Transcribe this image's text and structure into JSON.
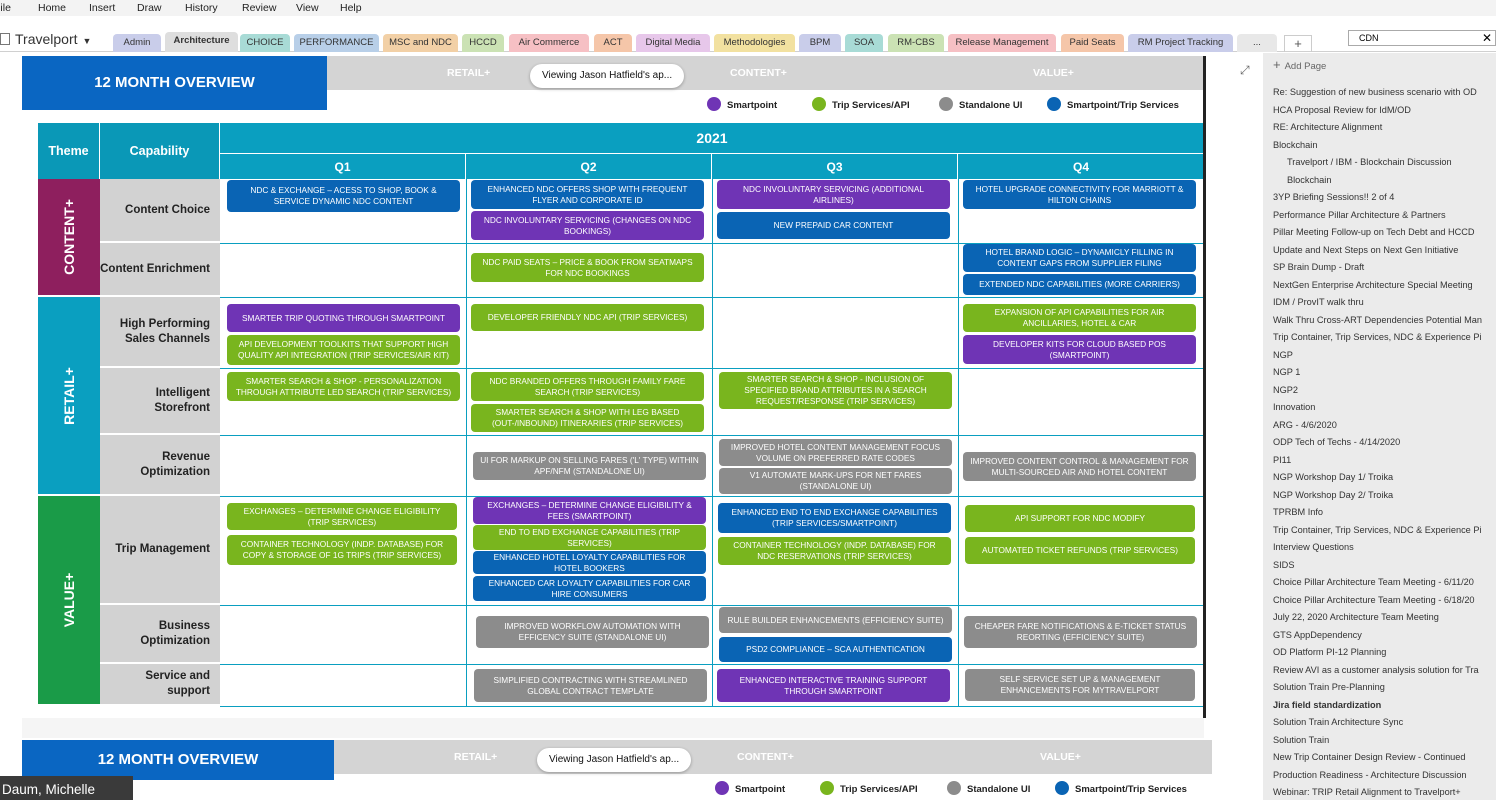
{
  "menu": [
    "File",
    "Home",
    "Insert",
    "Draw",
    "History",
    "Review",
    "View",
    "Help"
  ],
  "notebook": "Travelport",
  "tabs": [
    {
      "label": "Admin",
      "color": "#c9cdea"
    },
    {
      "label": "Architecture",
      "color": "#dedede"
    },
    {
      "label": "CHOICE",
      "color": "#a8dbd6"
    },
    {
      "label": "PERFORMANCE",
      "color": "#b8cfe8"
    },
    {
      "label": "MSC and NDC",
      "color": "#f2d0a6"
    },
    {
      "label": "HCCD",
      "color": "#cbe2b4"
    },
    {
      "label": "Air Commerce",
      "color": "#f6c0c4"
    },
    {
      "label": "ACT",
      "color": "#f5c6a9"
    },
    {
      "label": "Digital Media",
      "color": "#e7c7ea"
    },
    {
      "label": "Methodologies",
      "color": "#f2e1a0"
    },
    {
      "label": "BPM",
      "color": "#c9cdea"
    },
    {
      "label": "SOA",
      "color": "#a8dbd6"
    },
    {
      "label": "RM-CBS",
      "color": "#cbe2b4"
    },
    {
      "label": "Release Management",
      "color": "#f6c0c4"
    },
    {
      "label": "Paid Seats",
      "color": "#f5c6a9"
    },
    {
      "label": "RM Project Tracking",
      "color": "#c9cdea"
    },
    {
      "label": "...",
      "color": "#e8e8e8"
    }
  ],
  "search": {
    "value": "CDN"
  },
  "add_page": "Add Page",
  "pages": [
    {
      "label": "Re: Suggestion of new business scenario with OD"
    },
    {
      "label": "HCA Proposal Review for IdM/OD"
    },
    {
      "label": "RE: Architecture Alignment"
    },
    {
      "label": "Blockchain"
    },
    {
      "label": "Travelport / IBM - Blockchain Discussion",
      "sub": true
    },
    {
      "label": "Blockchain",
      "sub": true
    },
    {
      "label": "3YP Briefing Sessions!!  2 of 4"
    },
    {
      "label": "Performance Pillar Architecture & Partners"
    },
    {
      "label": "Pillar Meeting Follow-up on Tech Debt and HCCD"
    },
    {
      "label": "Update and Next Steps on Next Gen Initiative"
    },
    {
      "label": "SP Brain Dump - Draft"
    },
    {
      "label": "NextGen Enterprise Architecture  Special Meeting"
    },
    {
      "label": "IDM / ProvIT walk thru"
    },
    {
      "label": "Walk Thru Cross-ART Dependencies Potential Man"
    },
    {
      "label": "Trip Container, Trip Services, NDC & Experience Pi"
    },
    {
      "label": "NGP"
    },
    {
      "label": "NGP 1"
    },
    {
      "label": "NGP2"
    },
    {
      "label": "Innovation"
    },
    {
      "label": "ARG - 4/6/2020"
    },
    {
      "label": "ODP Tech of Techs - 4/14/2020"
    },
    {
      "label": "PI11"
    },
    {
      "label": "NGP Workshop Day 1/ Troika"
    },
    {
      "label": "NGP Workshop Day 2/ Troika"
    },
    {
      "label": "TPRBM Info"
    },
    {
      "label": "Trip Container, Trip Services, NDC & Experience Pi"
    },
    {
      "label": "Interview Questions"
    },
    {
      "label": "SIDS"
    },
    {
      "label": "Choice Pillar Architecture Team Meeting - 6/11/20"
    },
    {
      "label": "Choice Pillar Architecture Team Meeting - 6/18/20"
    },
    {
      "label": "July 22, 2020 Architecture Team Meeting"
    },
    {
      "label": "GTS AppDependency"
    },
    {
      "label": "OD Platform PI-12 Planning"
    },
    {
      "label": "Review AVI as a customer analysis solution for Tra"
    },
    {
      "label": "Solution Train Pre-Planning"
    },
    {
      "label": "Jira field standardization",
      "bold": true
    },
    {
      "label": "Solution Train Architecture Sync"
    },
    {
      "label": "Solution Train"
    },
    {
      "label": "New Trip Container Design Review - Continued"
    },
    {
      "label": "Production Readiness - Architecture Discussion"
    },
    {
      "label": "Webinar: TRIP Retail Alignment to Travelport+"
    }
  ],
  "slide": {
    "title": "12 MONTH OVERVIEW",
    "header_labels": [
      "RETAIL+",
      "CONTENT+",
      "VALUE+"
    ],
    "viewing": "Viewing Jason Hatfield's ap...",
    "legend": [
      {
        "label": "Smartpoint",
        "color": "#6f34b5"
      },
      {
        "label": "Trip Services/API",
        "color": "#79b51e"
      },
      {
        "label": "Standalone UI",
        "color": "#8c8c8c"
      },
      {
        "label": "Smartpoint/Trip Services",
        "color": "#0a64b4"
      }
    ],
    "col_theme": "Theme",
    "col_capability": "Capability",
    "year": "2021",
    "quarters": [
      "Q1",
      "Q2",
      "Q3",
      "Q4"
    ],
    "themes": [
      {
        "label": "CONTENT+",
        "color": "#8e1f5e"
      },
      {
        "label": "RETAIL+",
        "color": "#0a9fc0"
      },
      {
        "label": "VALUE+",
        "color": "#1a9b48"
      }
    ],
    "capabilities": [
      "Content Choice",
      "Content Enrichment",
      "High Performing Sales Channels",
      "Intelligent Storefront",
      "Revenue Optimization",
      "Trip Management",
      "Business Optimization",
      "Service and support"
    ],
    "items": [
      {
        "text": "NDC & EXCHANGE – ACESS TO SHOP, BOOK & SERVICE DYNAMIC NDC CONTENT",
        "color": "blue"
      },
      {
        "text": "ENHANCED NDC OFFERS SHOP WITH FREQUENT FLYER AND  CORPORATE ID",
        "color": "blue"
      },
      {
        "text": "NDC INVOLUNTARY SERVICING (CHANGES ON NDC BOOKINGS)",
        "color": "purple"
      },
      {
        "text": "NDC INVOLUNTARY SERVICING (ADDITIONAL AIRLINES)",
        "color": "purple"
      },
      {
        "text": "NEW PREPAID CAR CONTENT",
        "color": "blue"
      },
      {
        "text": "HOTEL UPGRADE CONNECTIVITY FOR MARRIOTT & HILTON CHAINS",
        "color": "blue"
      },
      {
        "text": "NDC PAID SEATS – PRICE & BOOK FROM SEATMAPS FOR NDC BOOKINGS",
        "color": "green"
      },
      {
        "text": "HOTEL BRAND LOGIC – DYNAMICLY FILLING IN CONTENT GAPS FROM SUPPLIER FILING",
        "color": "blue"
      },
      {
        "text": "EXTENDED NDC CAPABILITIES (MORE CARRIERS)",
        "color": "blue"
      },
      {
        "text": "SMARTER TRIP QUOTING THROUGH SMARTPOINT",
        "color": "purple"
      },
      {
        "text": "API DEVELOPMENT TOOLKITS THAT SUPPORT HIGH QUALITY API INTEGRATION (TRIP SERVICES/AIR KIT)",
        "color": "green"
      },
      {
        "text": "DEVELOPER FRIENDLY NDC API (TRIP SERVICES)",
        "color": "green"
      },
      {
        "text": "EXPANSION OF API CAPABILITIES FOR AIR ANCILLARIES, HOTEL & CAR",
        "color": "green"
      },
      {
        "text": "DEVELOPER KITS FOR CLOUD BASED POS (SMARTPOINT)",
        "color": "purple"
      },
      {
        "text": "SMARTER SEARCH & SHOP - PERSONALIZATION THROUGH ATTRIBUTE LED SEARCH (TRIP SERVICES)",
        "color": "green"
      },
      {
        "text": "NDC BRANDED OFFERS THROUGH FAMILY FARE SEARCH (TRIP SERVICES)",
        "color": "green"
      },
      {
        "text": "SMARTER SEARCH & SHOP WITH LEG BASED (OUT-/INBOUND) ITINERARIES (TRIP SERVICES)",
        "color": "green"
      },
      {
        "text": "SMARTER SEARCH & SHOP - INCLUSION OF SPECIFIED BRAND ATTRIBUTES IN A SEARCH REQUEST/RESPONSE  (TRIP SERVICES)",
        "color": "green"
      },
      {
        "text": "UI FOR MARKUP ON SELLING FARES ('L' TYPE) WITHIN APF/NFM (STANDALONE UI)",
        "color": "grey"
      },
      {
        "text": "IMPROVED HOTEL CONTENT MANAGEMENT FOCUS VOLUME ON PREFERRED RATE CODES",
        "color": "grey"
      },
      {
        "text": "V1 AUTOMATE MARK-UPS FOR NET FARES (STANDALONE UI)",
        "color": "grey"
      },
      {
        "text": "IMPROVED CONTENT CONTROL & MANAGEMENT FOR MULTI-SOURCED AIR AND HOTEL CONTENT",
        "color": "grey"
      },
      {
        "text": "EXCHANGES – DETERMINE CHANGE ELIGIBILITY (TRIP SERVICES)",
        "color": "green"
      },
      {
        "text": "CONTAINER TECHNOLOGY (INDP. DATABASE) FOR COPY & STORAGE OF 1G TRIPS  (TRIP SERVICES)",
        "color": "green"
      },
      {
        "text": "EXCHANGES – DETERMINE CHANGE ELIGIBILITY & FEES (SMARTPOINT)",
        "color": "purple"
      },
      {
        "text": "END TO END EXCHANGE CAPABILITIES (TRIP SERVICES)",
        "color": "green"
      },
      {
        "text": "ENHANCED HOTEL LOYALTY CAPABILITIES FOR HOTEL BOOKERS",
        "color": "blue"
      },
      {
        "text": "ENHANCED CAR LOYALTY CAPABILITIES FOR CAR HIRE CONSUMERS",
        "color": "blue"
      },
      {
        "text": "ENHANCED END TO END EXCHANGE CAPABILITIES (TRIP SERVICES/SMARTPOINT)",
        "color": "blue"
      },
      {
        "text": "CONTAINER TECHNOLOGY (INDP. DATABASE) FOR NDC RESERVATIONS (TRIP SERVICES)",
        "color": "green"
      },
      {
        "text": "API SUPPORT FOR NDC MODIFY",
        "color": "green"
      },
      {
        "text": "AUTOMATED TICKET REFUNDS (TRIP SERVICES)",
        "color": "green"
      },
      {
        "text": "IMPROVED WORKFLOW AUTOMATION WITH EFFICENCY SUITE (STANDALONE UI)",
        "color": "grey"
      },
      {
        "text": "RULE BUILDER ENHANCEMENTS (EFFICIENCY SUITE)",
        "color": "grey"
      },
      {
        "text": "PSD2 COMPLIANCE – SCA AUTHENTICATION",
        "color": "blue"
      },
      {
        "text": "CHEAPER FARE NOTIFICATIONS & E-TICKET STATUS REORTING (EFFICIENCY SUITE)",
        "color": "grey"
      },
      {
        "text": "SIMPLIFIED CONTRACTING WITH STREAMLINED GLOBAL CONTRACT TEMPLATE",
        "color": "grey"
      },
      {
        "text": "ENHANCED INTERACTIVE TRAINING SUPPORT THROUGH SMARTPOINT",
        "color": "purple"
      },
      {
        "text": "SELF SERVICE SET UP & MANAGEMENT ENHANCEMENTS FOR MYTRAVELPORT",
        "color": "grey"
      }
    ]
  },
  "participant": "Daum, Michelle"
}
